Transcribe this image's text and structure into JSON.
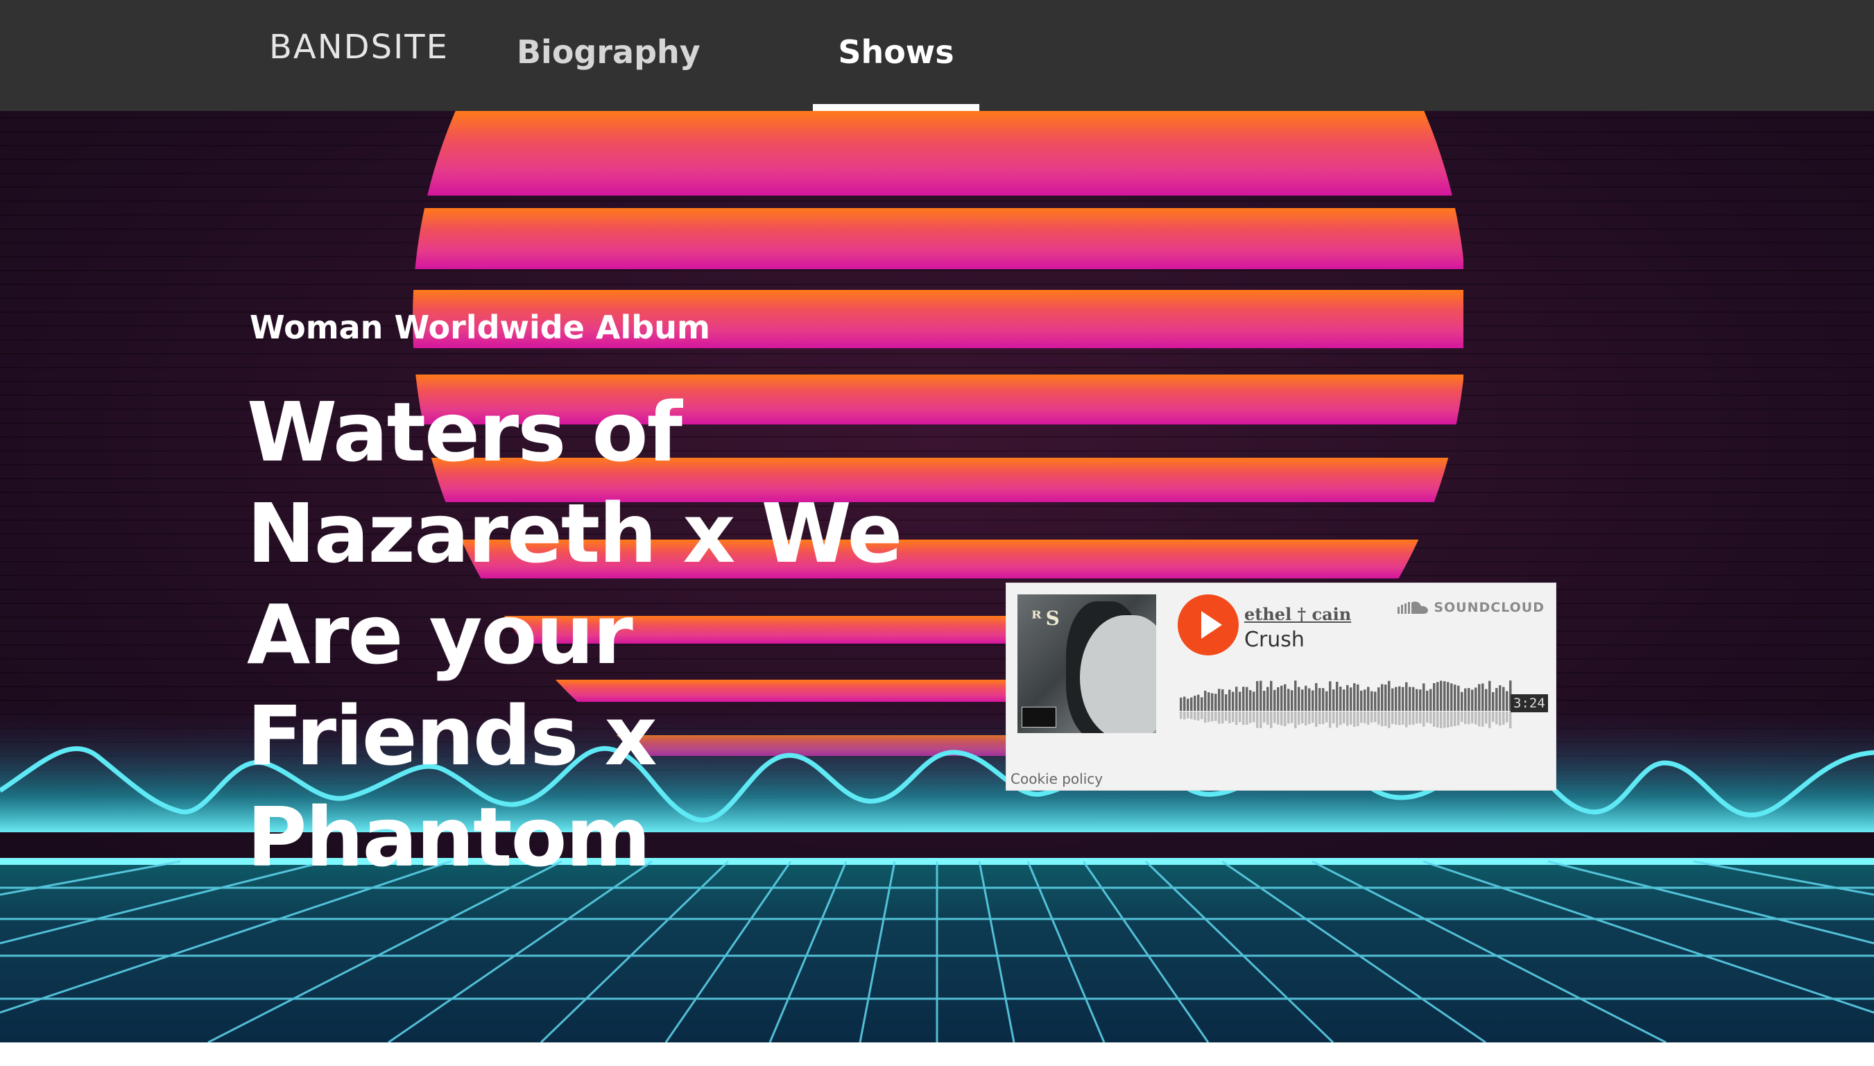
{
  "nav": {
    "logo": "BANDSITE",
    "links": [
      {
        "label": "Biography",
        "active": false
      },
      {
        "label": "Shows",
        "active": true
      }
    ]
  },
  "hero": {
    "subtitle": "Woman Worldwide Album",
    "title": "Waters of Nazareth x We Are your Friends x Phantom"
  },
  "player": {
    "artist": "ethel † cain",
    "track": "Crush",
    "brand": "SOUNDCLOUD",
    "duration": "3:24",
    "cookie_policy": "Cookie policy",
    "play_color": "#f24a1a"
  },
  "colors": {
    "nav_bg": "#323232",
    "sun_top": "#ff7a1a",
    "sun_bottom": "#e0189a",
    "neon": "#39e6f0"
  }
}
